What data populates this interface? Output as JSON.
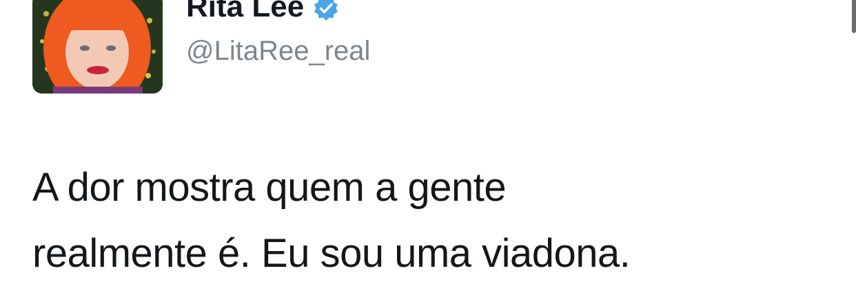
{
  "tweet": {
    "display_name": "Rita Lee",
    "handle": "@LitaRee_real",
    "text_lines": [
      "A dor mostra quem a gente",
      "realmente é. Eu sou uma viadona."
    ]
  },
  "icons": {
    "verified": "verified-badge-icon",
    "avatar": "profile-photo"
  },
  "colors": {
    "verified_badge": "#4aa4e8",
    "name": "#141823",
    "handle": "#7d858c",
    "text": "#14171a"
  }
}
